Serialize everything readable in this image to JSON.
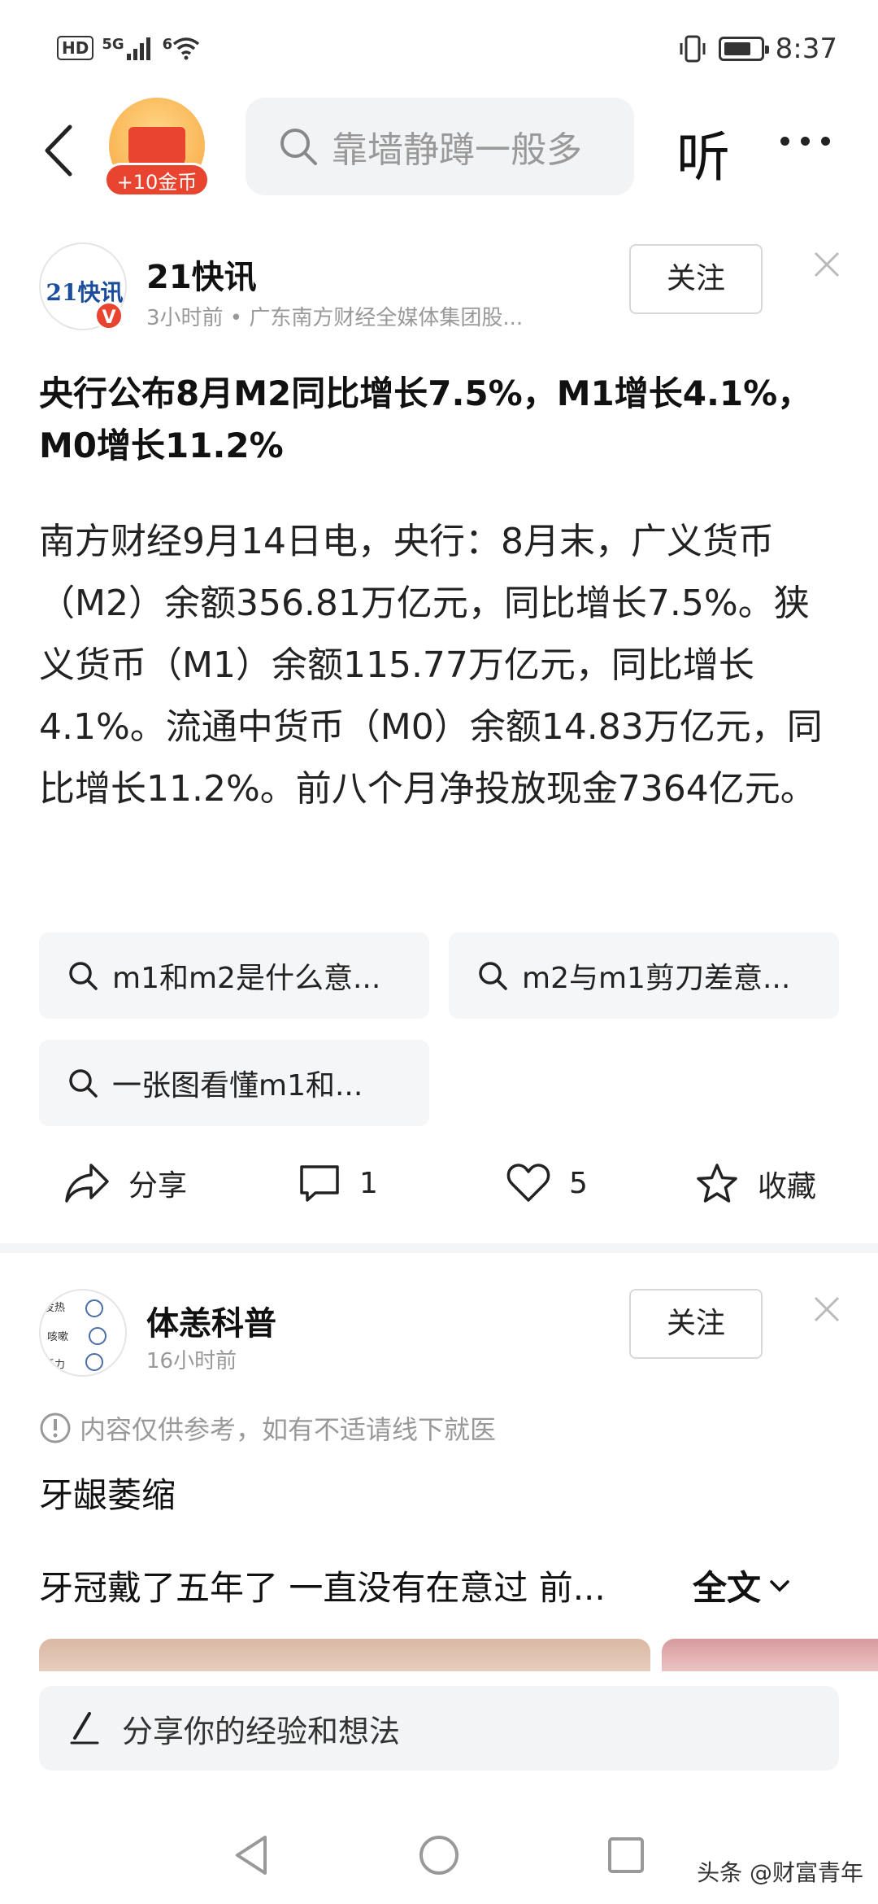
{
  "status_bar": {
    "hd": "HD",
    "signal_label": "5G",
    "wifi_label": "6",
    "time": "8:37"
  },
  "top_nav": {
    "coin_reward": "+10金币",
    "search_placeholder": "靠墙静蹲一般多",
    "listen_label": "听"
  },
  "post1": {
    "avatar_text": "21快讯",
    "verified_mark": "V",
    "author": "21快讯",
    "meta": "3小时前 • 广东南方财经全媒体集团股...",
    "follow_label": "关注",
    "headline": "央行公布8月M2同比增长7.5%，M1增长4.1%，M0增长11.2%",
    "body": "南方财经9月14日电，央行：8月末，广义货币（M2）余额356.81万亿元，同比增长7.5%。狭义货币（M1）余额115.77万亿元，同比增长4.1%。流通中货币（M0）余额14.83万亿元，同比增长11.2%。前八个月净投放现金7364亿元。",
    "related_searches": [
      "m1和m2是什么意...",
      "m2与m1剪刀差意...",
      "一张图看懂m1和..."
    ],
    "actions": {
      "share": "分享",
      "comments": "1",
      "likes": "5",
      "favorite": "收藏"
    }
  },
  "post2": {
    "avatar_labels": [
      "发热",
      "咳嗽",
      "乏力"
    ],
    "author": "体恙科普",
    "meta": "16小时前",
    "follow_label": "关注",
    "disclaimer": "内容仅供参考，如有不适请线下就医",
    "title": "牙龈萎缩",
    "body_preview": "牙冠戴了五年了 一直没有在意过 前...",
    "fulltext_label": "全文"
  },
  "comment_bar": {
    "placeholder": "分享你的经验和想法"
  },
  "watermark": "头条 @财富青年",
  "colors": {
    "accent_red": "#e8442f",
    "coin_gold": "#f7a53b",
    "chip_bg": "#f5f6f7",
    "muted_text": "#999999"
  }
}
